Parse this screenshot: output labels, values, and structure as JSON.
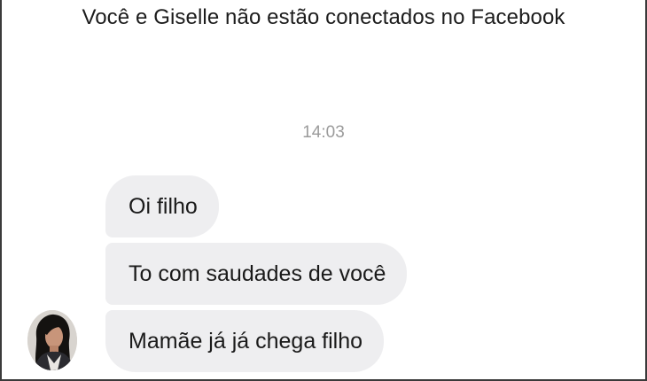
{
  "header": {
    "connection_notice": "Você e Giselle não estão conectados no Facebook"
  },
  "conversation": {
    "timestamp": "14:03",
    "contact_name": "Giselle",
    "messages": [
      {
        "sender": "Giselle",
        "text": "Oi filho"
      },
      {
        "sender": "Giselle",
        "text": "To com saudades de você"
      },
      {
        "sender": "Giselle",
        "text": "Mamãe já já chega filho"
      }
    ]
  },
  "colors": {
    "bubble_background": "#eeeef0",
    "timestamp_text": "#9b9b9b",
    "page_background": "#ffffff"
  }
}
